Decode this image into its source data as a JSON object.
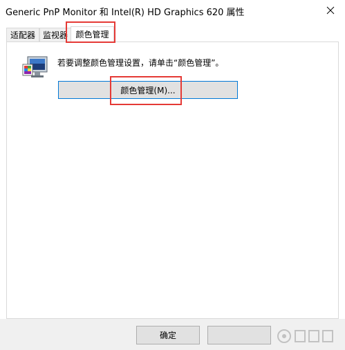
{
  "window": {
    "title": "Generic PnP Monitor 和 Intel(R) HD Graphics 620 属性"
  },
  "tabs": [
    {
      "label": "适配器",
      "selected": false
    },
    {
      "label": "监视器",
      "selected": false
    },
    {
      "label": "颜色管理",
      "selected": true
    }
  ],
  "color_management": {
    "instruction": "若要调整颜色管理设置，请单击“颜色管理”。",
    "button_label": "颜色管理(M)..."
  },
  "footer": {
    "ok_label": "确定",
    "cancel_label": ""
  },
  "colors": {
    "highlight_frame": "#e53935",
    "focus_border": "#0078d7"
  },
  "icons": {
    "window_close": "close-icon",
    "display": "monitor-color-icon",
    "watermark": "watermark-logo-icon"
  }
}
